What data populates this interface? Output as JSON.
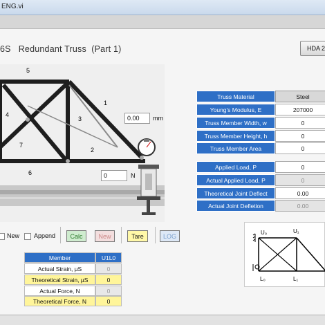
{
  "window": {
    "title": "ENG.vi"
  },
  "heading": {
    "text": "6S   Redundant Truss  (Part 1)"
  },
  "hda_button": {
    "label": "HDA 2"
  },
  "photo": {
    "member_labels": [
      "5",
      "1",
      "4",
      "3",
      "7",
      "2",
      "6"
    ],
    "dial_value": "0.00",
    "dial_unit": "mm",
    "load_value": "0",
    "load_unit": "N"
  },
  "properties": [
    {
      "label": "Truss Material",
      "value": "Steel",
      "style": "steel"
    },
    {
      "label": "Young's Modulus, E",
      "value": "207000",
      "style": "white"
    },
    {
      "label": "Truss Member Width, w",
      "value": "0",
      "style": "white"
    },
    {
      "label": "Truss Member Height, h",
      "value": "0",
      "style": "white"
    },
    {
      "label": "Truss Member Area",
      "value": "0",
      "style": "white"
    },
    {
      "label": "Applied Load, P",
      "value": "0",
      "style": "white"
    },
    {
      "label": "Actual Applied Load, P",
      "value": "0",
      "style": "gray"
    },
    {
      "label": "Theoretical Joint Deflect",
      "value": "0.00",
      "style": "white"
    },
    {
      "label": "Actual Joint Defletion",
      "value": "0.00",
      "style": "gray"
    }
  ],
  "controls": {
    "new_label": "New",
    "append_label": "Append",
    "calc_label": "Calc",
    "new_button_label": "New",
    "tare_label": "Tare",
    "log_label": "LOG"
  },
  "member_table": {
    "headers": [
      "Member",
      "U1L0"
    ],
    "rows": [
      {
        "label": "Actual Strain, µS",
        "value": "0",
        "highlight": false
      },
      {
        "label": "Theoretical Strain, µS",
        "value": "0",
        "highlight": true
      },
      {
        "label": "Actual Force, N",
        "value": "0",
        "highlight": false
      },
      {
        "label": "Theoretical Force, N",
        "value": "0",
        "highlight": true
      }
    ]
  },
  "diagram": {
    "joints": [
      "U₀",
      "U₁",
      "L₀",
      "L₁"
    ]
  },
  "colors": {
    "label_blue": "#2e6fc6",
    "highlight_yellow": "#fff59a",
    "header_blue": "#2e6fc6"
  }
}
